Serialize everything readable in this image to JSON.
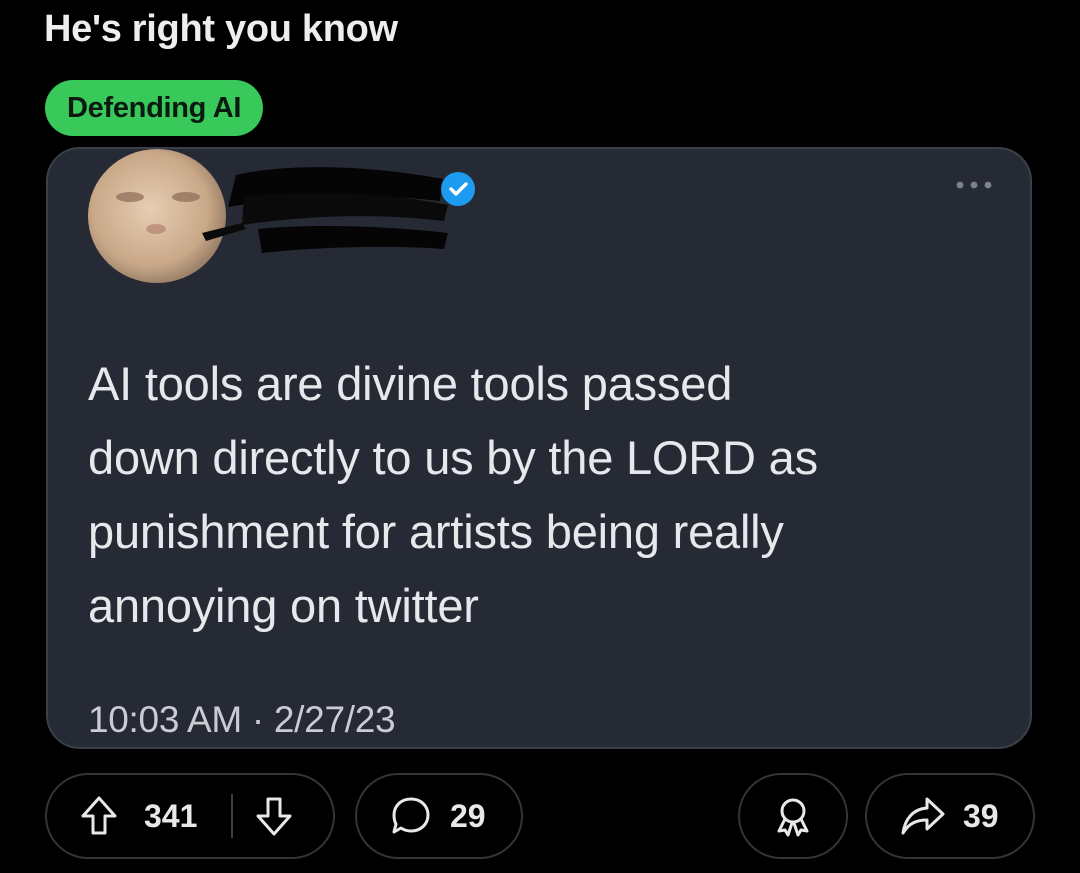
{
  "post": {
    "title": "He's right you know",
    "flair": "Defending AI",
    "flair_color": "#38c95a"
  },
  "tweet": {
    "text": "AI tools are divine tools passed\ndown directly to us by the LORD as\npunishment for artists being really\nannoying on twitter",
    "timestamp": "10:03 AM · 2/27/23",
    "verified_color": "#1d9bf0",
    "card_color": "#262a34"
  },
  "actions": {
    "upvotes": "341",
    "comments": "29",
    "shares": "39"
  },
  "icons": {
    "upvote": "upvote-arrow-icon",
    "downvote": "downvote-arrow-icon",
    "comment": "comment-bubble-icon",
    "award": "award-icon",
    "share": "share-arrow-icon",
    "more": "more-options-icon",
    "verified": "verified-badge-icon"
  }
}
